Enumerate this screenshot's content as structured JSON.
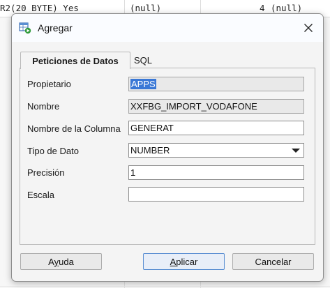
{
  "background_table": {
    "cells": [
      "R2(20 BYTE) Yes",
      "(null)",
      "4",
      "(null)"
    ]
  },
  "dialog": {
    "title": "Agregar",
    "icon": "add-table-icon",
    "close_icon": "close-icon"
  },
  "tabs": [
    {
      "label": "Peticiones de Datos",
      "active": true
    },
    {
      "label": "SQL",
      "active": false
    }
  ],
  "form": {
    "owner_label": "Propietario",
    "owner_value": "APPS",
    "name_label": "Nombre",
    "name_value": "XXFBG_IMPORT_VODAFONE",
    "column_label": "Nombre de la Columna",
    "column_value": "GENERAT",
    "type_label": "Tipo de Dato",
    "type_value": "NUMBER",
    "precision_label": "Precisión",
    "precision_value": "1",
    "scale_label": "Escala",
    "scale_value": ""
  },
  "buttons": {
    "help_label": "Ayuda",
    "help_mnemonic": "y",
    "apply_label": "Aplicar",
    "apply_mnemonic": "A",
    "cancel_label": "Cancelar"
  },
  "colors": {
    "selection": "#3a78d6",
    "accent_border": "#5b8fd2",
    "dialog_bg": "#f4f4f4"
  }
}
